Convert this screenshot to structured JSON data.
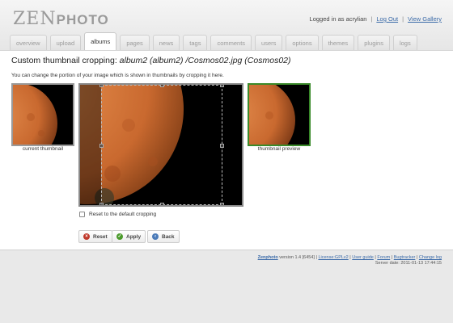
{
  "header": {
    "logo_zen": "ZEN",
    "logo_photo": "PHOTO",
    "logged_in_text": "Logged in as acrylian",
    "logout_label": "Log Out",
    "view_gallery_label": "View Gallery",
    "separator": "|"
  },
  "tabs": [
    {
      "label": "overview",
      "active": false
    },
    {
      "label": "upload",
      "active": false
    },
    {
      "label": "albums",
      "active": true
    },
    {
      "label": "pages",
      "active": false
    },
    {
      "label": "news",
      "active": false
    },
    {
      "label": "tags",
      "active": false
    },
    {
      "label": "comments",
      "active": false
    },
    {
      "label": "users",
      "active": false
    },
    {
      "label": "options",
      "active": false
    },
    {
      "label": "themes",
      "active": false
    },
    {
      "label": "plugins",
      "active": false
    },
    {
      "label": "logs",
      "active": false
    }
  ],
  "main": {
    "title_prefix": "Custom thumbnail cropping: ",
    "title_italic": "album2 (album2) /Cosmos02.jpg (Cosmos02)",
    "description": "You can change the portion of your image which is shown in thumbnails by cropping it here.",
    "current_thumb_caption": "current thumbnail",
    "preview_caption": "thumbnail preview",
    "reset_label": "Reset to the default cropping",
    "buttons": {
      "reset": "Reset",
      "apply": "Apply",
      "back": "Back"
    }
  },
  "footer": {
    "brand": "Zenphoto",
    "version": " version 1.4 [6454] |",
    "license": "License:GPLv2",
    "sep": "|",
    "user_guide": "User guide",
    "forum": "Forum",
    "bugtracker": "Bugtracker",
    "changelog": "Change log",
    "server_date": "Server date: 2011-01-13 17:44:15"
  },
  "colors": {
    "accent_link": "#3a6aa8",
    "preview_border": "#3a8a2a",
    "planet": "#c9692f"
  }
}
